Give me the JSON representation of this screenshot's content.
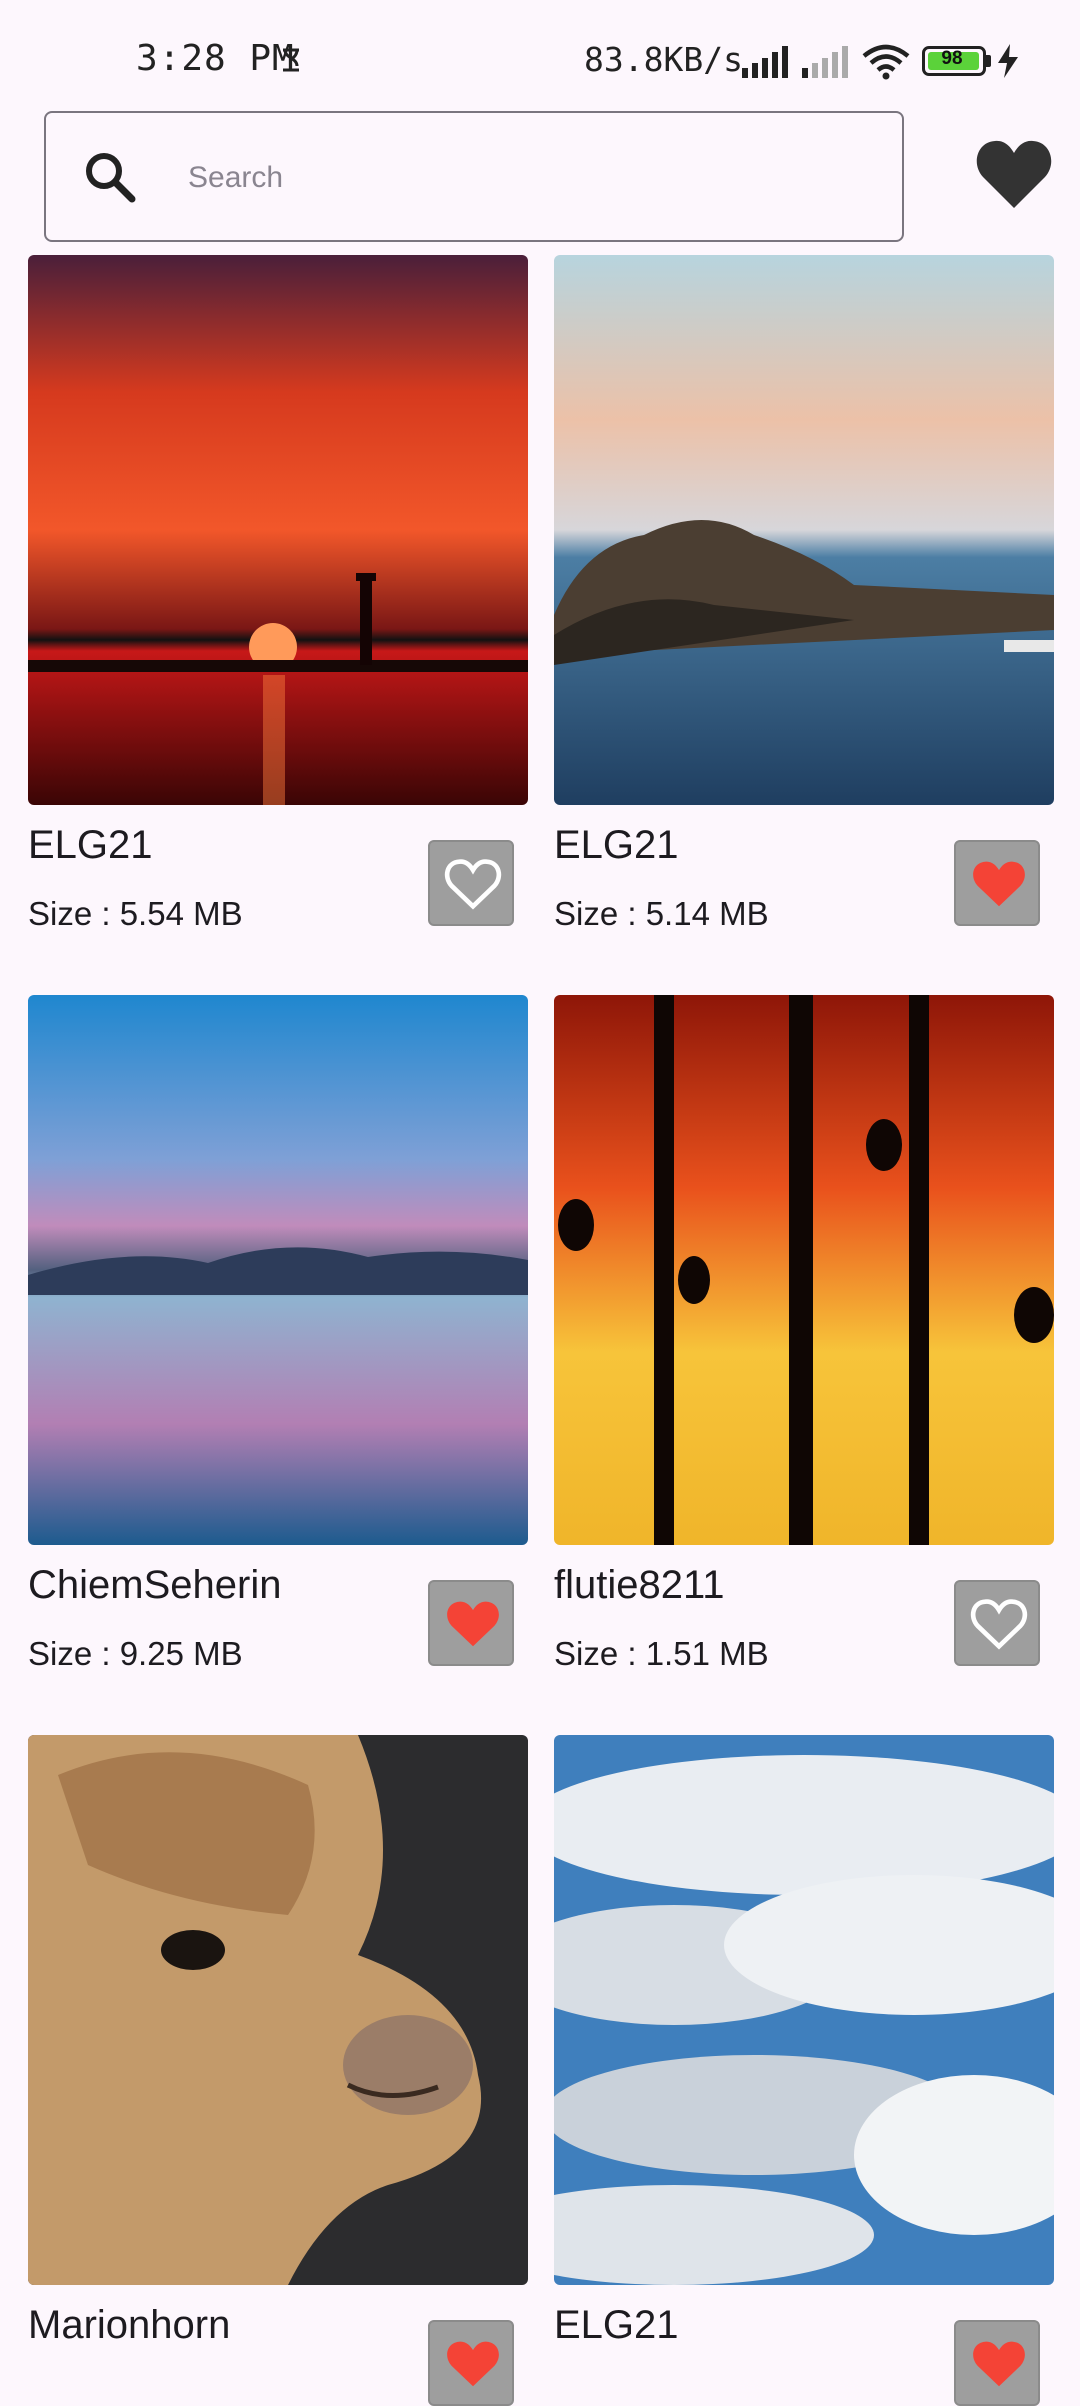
{
  "status_bar": {
    "time": "3:28 PM",
    "net_speed": "83.8KB/s",
    "battery_level": "98",
    "battery_fill": 0.98
  },
  "search": {
    "placeholder": "Search",
    "value": ""
  },
  "colors": {
    "accent_heart": "#f44336",
    "fav_button_bg": "#9e9e9e",
    "header_heart": "#333333",
    "background": "#fdf7fd"
  },
  "icons": {
    "search": "search-icon",
    "favorites": "heart-icon",
    "favorite_on": "heart-filled-icon",
    "favorite_off": "heart-outline-icon"
  },
  "cards": [
    {
      "title": "ELG21",
      "size": "Size : 5.54 MB",
      "favorite": false,
      "image": "sunset-lighthouse"
    },
    {
      "title": "ELG21",
      "size": "Size : 5.14 MB",
      "favorite": true,
      "image": "rocky-island-sea"
    },
    {
      "title": "ChiemSeherin",
      "size": "Size : 9.25 MB",
      "favorite": true,
      "image": "lake-reflection"
    },
    {
      "title": "flutie8211",
      "size": "Size : 1.51 MB",
      "favorite": false,
      "image": "birds-on-trees-sunset"
    },
    {
      "title": "Marionhorn",
      "size": "",
      "favorite": true,
      "image": "alpaca"
    },
    {
      "title": "ELG21",
      "size": "",
      "favorite": true,
      "image": "cloudy-sky"
    }
  ]
}
